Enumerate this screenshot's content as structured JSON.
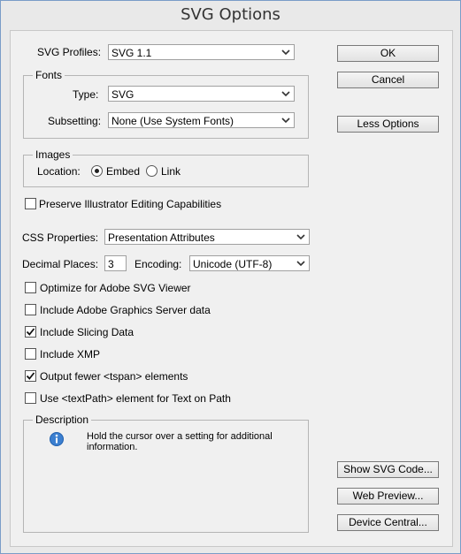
{
  "title": "SVG Options",
  "svg_profiles": {
    "label": "SVG Profiles:",
    "value": "SVG 1.1"
  },
  "fonts": {
    "group_label": "Fonts",
    "type_label": "Type:",
    "type_value": "SVG",
    "subsetting_label": "Subsetting:",
    "subsetting_value": "None (Use System Fonts)"
  },
  "images": {
    "group_label": "Images",
    "location_label": "Location:",
    "embed_label": "Embed",
    "link_label": "Link",
    "selected": "Embed"
  },
  "preserve": {
    "label": "Preserve Illustrator Editing Capabilities",
    "checked": false
  },
  "css": {
    "label": "CSS Properties:",
    "value": "Presentation Attributes"
  },
  "decimal": {
    "label": "Decimal Places:",
    "value": "3"
  },
  "encoding": {
    "label": "Encoding:",
    "value": "Unicode (UTF-8)"
  },
  "options": [
    {
      "label": "Optimize for Adobe SVG Viewer",
      "checked": false
    },
    {
      "label": "Include Adobe Graphics Server data",
      "checked": false
    },
    {
      "label": "Include Slicing Data",
      "checked": true
    },
    {
      "label": "Include XMP",
      "checked": false
    },
    {
      "label": "Output fewer <tspan> elements",
      "checked": true
    },
    {
      "label": "Use <textPath> element for Text on Path",
      "checked": false
    }
  ],
  "description": {
    "group_label": "Description",
    "text": "Hold the cursor over a setting for additional information."
  },
  "buttons": {
    "ok": "OK",
    "cancel": "Cancel",
    "less_options": "Less Options",
    "show_svg_code": "Show SVG Code...",
    "web_preview": "Web Preview...",
    "device_central": "Device Central..."
  },
  "colors": {
    "info_icon": "#3b7fd0",
    "border_accent": "#7a9cc8"
  }
}
